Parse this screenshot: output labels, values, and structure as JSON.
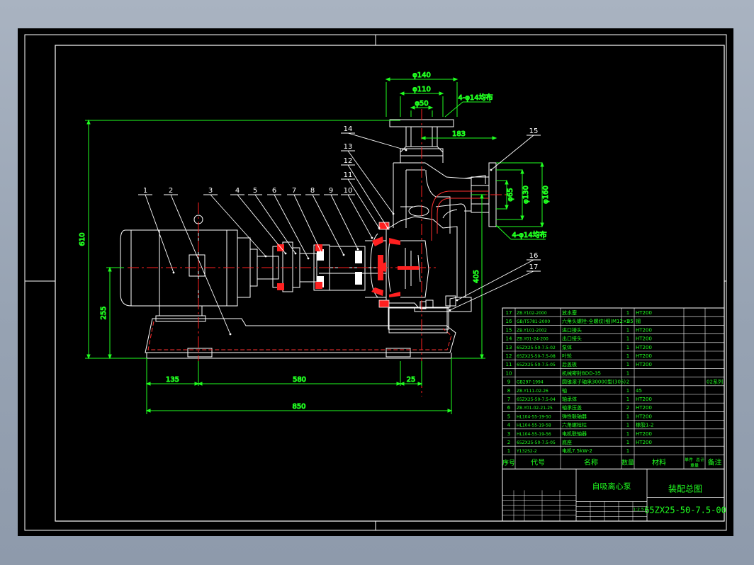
{
  "colors": {
    "background": "#000000",
    "frame": "#ffffff",
    "part": "#ffffff",
    "centerline": "#ff2020",
    "dimension": "#20ff20",
    "leader": "#ffffff",
    "title_block_text": "#20ff20",
    "desktop": "#9aa6b6"
  },
  "dimensions": {
    "flange_outer_top": "φ140",
    "flange_bolt_top": "φ110",
    "flange_bore_top": "φ50",
    "flange_holes_top": "4-φ14均布",
    "offset": "183",
    "flange_bore_side": "φ65",
    "flange_bolt_side": "φ130",
    "flange_outer_side": "φ160",
    "flange_holes_side": "4-φ14均布",
    "overall_height": "610",
    "shaft_height": "255",
    "outlet_height": "405",
    "base_left": "135",
    "base_mid": "580",
    "base_right": "25",
    "overall_length": "850"
  },
  "balloons": [
    "1",
    "2",
    "3",
    "4",
    "5",
    "6",
    "7",
    "8",
    "9",
    "10",
    "11",
    "12",
    "13",
    "14",
    "15",
    "16",
    "17"
  ],
  "bom": {
    "rows": [
      {
        "no": "17",
        "code": "ZB.Y102-2000",
        "name": "放水塞",
        "qty": "1",
        "material": "HT200",
        "remark": ""
      },
      {
        "no": "16",
        "code": "GB/T5781-2000",
        "name": "六角头螺栓-全螺纹(细)M12×85",
        "qty": "1",
        "material": "钢",
        "remark": ""
      },
      {
        "no": "15",
        "code": "ZB.Y101-2002",
        "name": "进口接头",
        "qty": "1",
        "material": "HT200",
        "remark": ""
      },
      {
        "no": "14",
        "code": "ZB.Y01-24-200",
        "name": "出口接头",
        "qty": "1",
        "material": "HT200",
        "remark": ""
      },
      {
        "no": "13",
        "code": "65ZX25-50-7.5-02",
        "name": "泵体",
        "qty": "1",
        "material": "HT200",
        "remark": ""
      },
      {
        "no": "12",
        "code": "65ZX25-50-7.5-08",
        "name": "叶轮",
        "qty": "1",
        "material": "HT200",
        "remark": ""
      },
      {
        "no": "11",
        "code": "65ZX25-50-7.5-05",
        "name": "后盖板",
        "qty": "1",
        "material": "HT200",
        "remark": ""
      },
      {
        "no": "10",
        "code": "",
        "name": "机械密封BDD-35",
        "qty": "1",
        "material": "",
        "remark": ""
      },
      {
        "no": "9",
        "code": "GB297-1994",
        "name": "圆锥滚子轴承30000型(305)",
        "qty": "2",
        "material": "",
        "remark": "02系列"
      },
      {
        "no": "8",
        "code": "ZB.Y111-02-26",
        "name": "轴",
        "qty": "1",
        "material": "45",
        "remark": ""
      },
      {
        "no": "7",
        "code": "65ZX25-50-7.5-04",
        "name": "轴承体",
        "qty": "1",
        "material": "HT200",
        "remark": ""
      },
      {
        "no": "6",
        "code": "ZB.Y01-02-21-25",
        "name": "轴承压盖",
        "qty": "2",
        "material": "HT200",
        "remark": ""
      },
      {
        "no": "5",
        "code": "HL104-55-19-50",
        "name": "弹性联轴器",
        "qty": "1",
        "material": "HT200",
        "remark": ""
      },
      {
        "no": "4",
        "code": "HL104-55-19-58",
        "name": "六角螺栓柱",
        "qty": "1",
        "material": "橡胶1-2",
        "remark": ""
      },
      {
        "no": "3",
        "code": "HL104-55-19-56",
        "name": "电机联轴器",
        "qty": "1",
        "material": "HT200",
        "remark": ""
      },
      {
        "no": "2",
        "code": "65ZX25-50-7.5-05",
        "name": "底座",
        "qty": "1",
        "material": "HT200",
        "remark": ""
      },
      {
        "no": "1",
        "code": "Y132S2-2",
        "name": "电机7.5kW-2",
        "qty": "1",
        "material": "",
        "remark": ""
      }
    ],
    "headers": {
      "no": "序号",
      "code": "代号",
      "name": "名称",
      "qty": "数量",
      "material": "材料",
      "unit_weight": "单件",
      "total_weight": "总计",
      "weight": "重量",
      "remark": "备注"
    }
  },
  "title_block": {
    "product_name": "自吸离心泵",
    "drawing_title": "装配总图",
    "drawing_number": "65ZX25-50-7.5-00",
    "scale": "1:2.5"
  }
}
